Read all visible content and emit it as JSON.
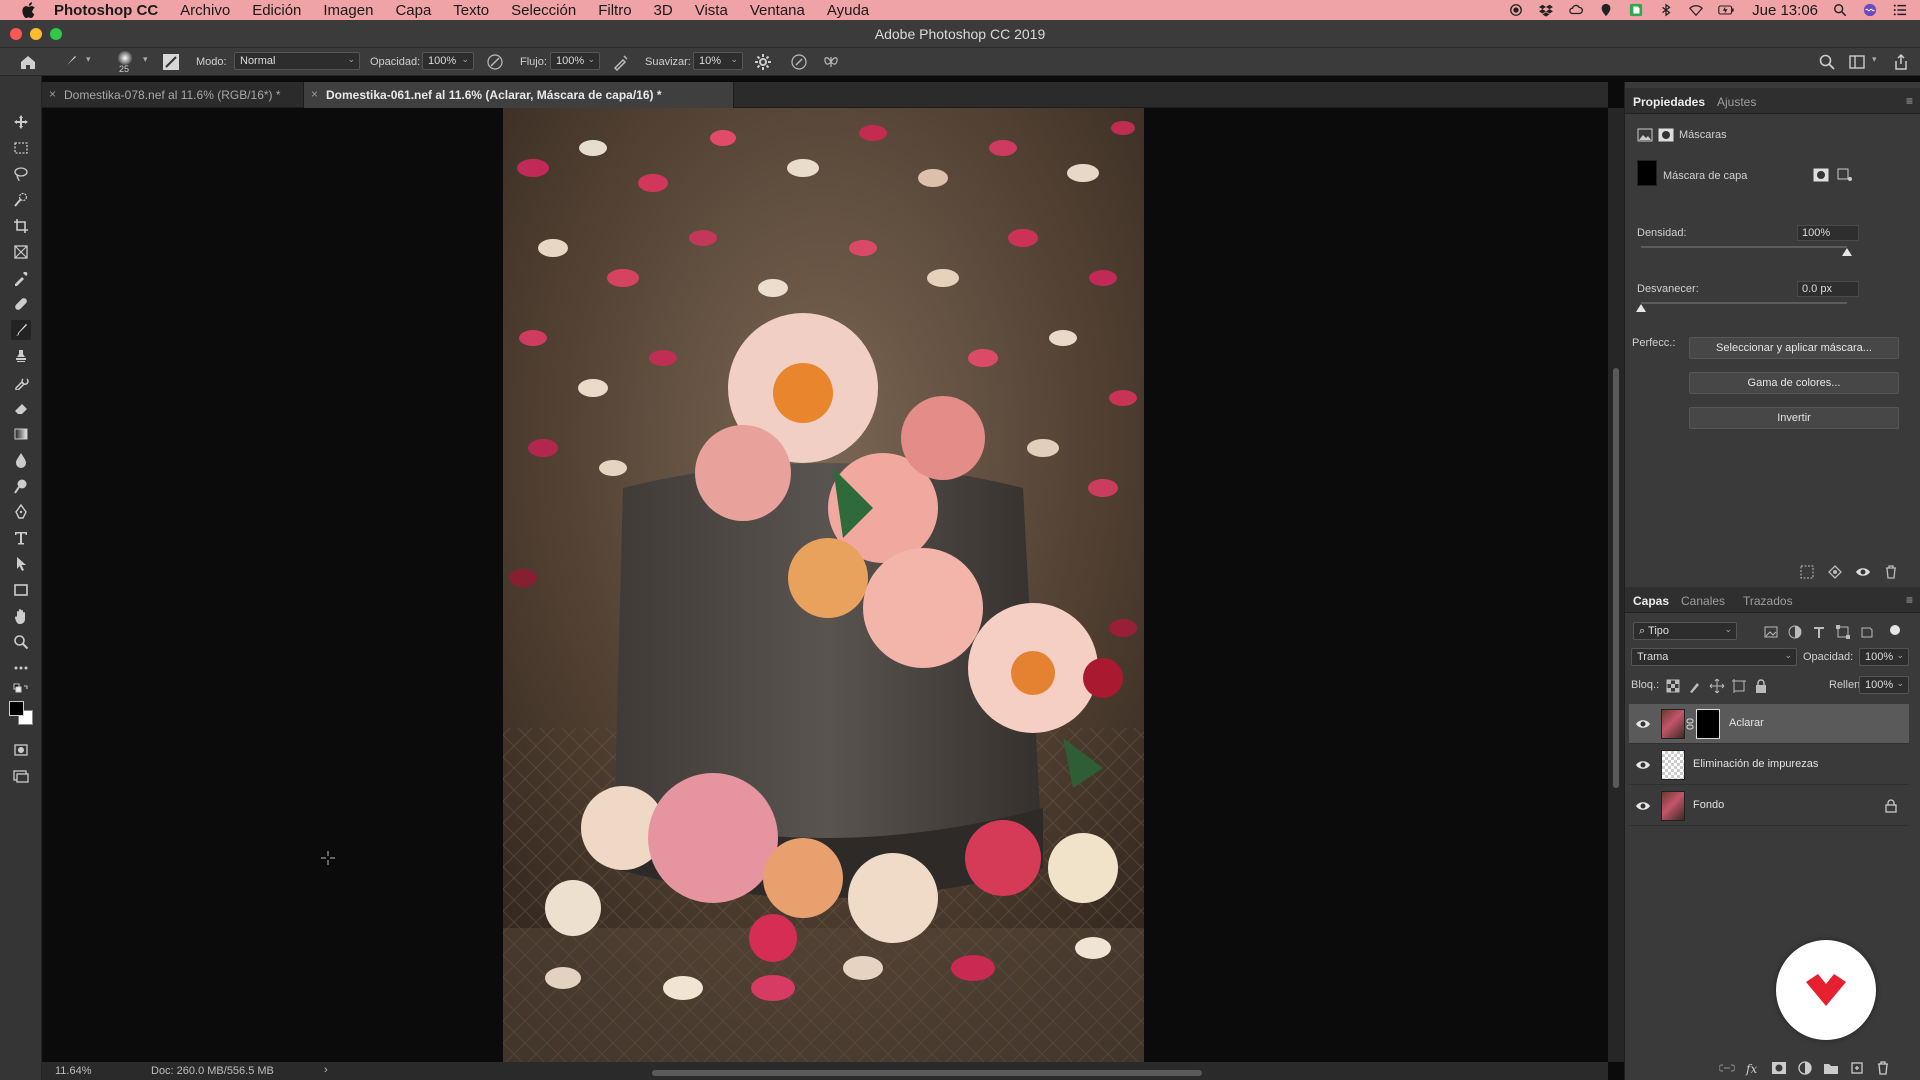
{
  "menubar": {
    "app_name": "Photoshop CC",
    "items": [
      "Archivo",
      "Edición",
      "Imagen",
      "Capa",
      "Texto",
      "Selección",
      "Filtro",
      "3D",
      "Vista",
      "Ventana",
      "Ayuda"
    ],
    "clock": "Jue 13:06",
    "background": "#f0a3a6"
  },
  "window": {
    "title": "Adobe Photoshop CC 2019"
  },
  "options": {
    "brush_size": "25",
    "mode_label": "Modo:",
    "mode_value": "Normal",
    "opacity_label": "Opacidad:",
    "opacity_value": "100%",
    "flow_label": "Flujo:",
    "flow_value": "100%",
    "smooth_label": "Suavizar:",
    "smooth_value": "10%"
  },
  "tabs": [
    {
      "label": "Domestika-078.nef al 11.6% (RGB/16*) *",
      "active": false
    },
    {
      "label": "Domestika-061.nef al 11.6% (Aclarar, Máscara de capa/16) *",
      "active": true
    }
  ],
  "status": {
    "zoom": "11.64%",
    "doc": "Doc: 260.0 MB/556.5 MB",
    "arrow": "›"
  },
  "properties": {
    "tabs": [
      "Propiedades",
      "Ajustes"
    ],
    "section": "Máscaras",
    "mask_label": "Máscara de capa",
    "density_label": "Densidad:",
    "density_value": "100%",
    "density_level": 1.0,
    "feather_label": "Desvanecer:",
    "feather_value": "0.0 px",
    "feather_level": 0.0,
    "refine_label": "Perfecc.:",
    "buttons": [
      "Seleccionar y aplicar máscara...",
      "Gama de colores...",
      "Invertir"
    ]
  },
  "layers_panel": {
    "tabs": [
      "Capas",
      "Canales",
      "Trazados"
    ],
    "filter_value": "Tipo",
    "blend_mode": "Trama",
    "opacity_label": "Opacidad:",
    "opacity_value": "100%",
    "lock_label": "Bloq.:",
    "fill_label": "Relleno:",
    "fill_value": "100%",
    "layers": [
      {
        "name": "Aclarar",
        "selected": true,
        "has_mask": true
      },
      {
        "name": "Eliminación de impurezas",
        "selected": false,
        "has_mask": false
      },
      {
        "name": "Fondo",
        "selected": false,
        "has_mask": false,
        "locked": true
      }
    ]
  },
  "colors": {
    "accent_logo": "#e5202f",
    "panel_bg": "#3a3a3a"
  }
}
